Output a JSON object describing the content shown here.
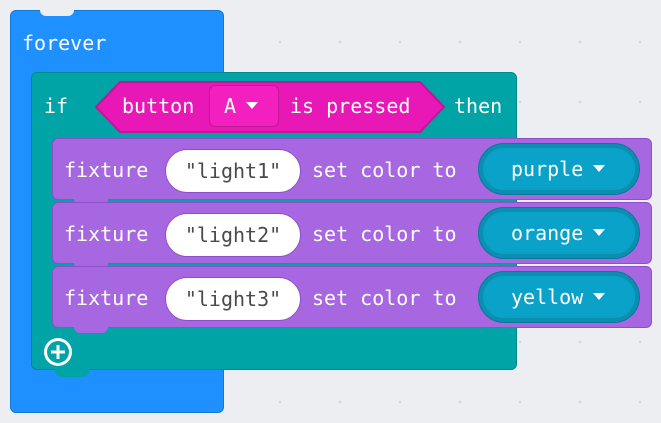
{
  "workspace": {
    "forever": {
      "label": "forever",
      "color": "#1e90ff"
    },
    "if_block": {
      "if_label": "if",
      "then_label": "then",
      "color": "#00a4a6",
      "condition": {
        "prefix": "button",
        "dropdown_value": "A",
        "suffix": "is pressed",
        "color": "#e718b6"
      },
      "add_icon": "plus-circle-icon"
    },
    "statements": [
      {
        "label": "fixture",
        "fixture_name": "\"light1\"",
        "action": "set color to",
        "color_value": "purple"
      },
      {
        "label": "fixture",
        "fixture_name": "\"light2\"",
        "action": "set color to",
        "color_value": "orange"
      },
      {
        "label": "fixture",
        "fixture_name": "\"light3\"",
        "action": "set color to",
        "color_value": "yellow"
      }
    ],
    "statement_color": "#a667e0",
    "color_pill_color": "#0ba2ca"
  }
}
